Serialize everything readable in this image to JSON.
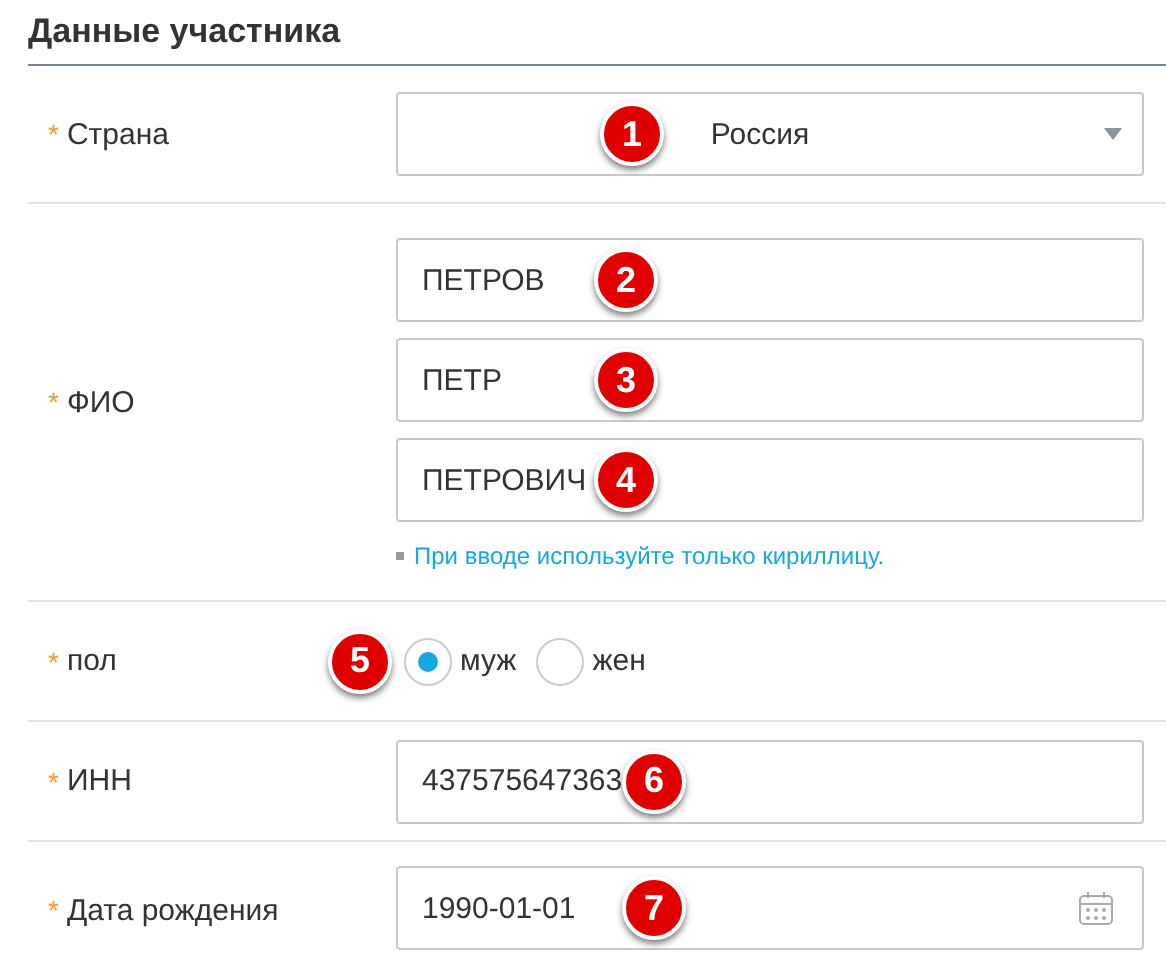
{
  "section_title": "Данные участника",
  "rows": [
    {
      "kind": "select",
      "label": "Страна",
      "required_mark": "*",
      "value": "Россия",
      "marker": "1"
    },
    {
      "kind": "fields",
      "label": "ФИО",
      "required_mark": "*",
      "fields": [
        {
          "value": "ПЕТРОВ",
          "marker": "2"
        },
        {
          "value": "ПЕТР",
          "marker": "3"
        },
        {
          "value": "ПЕТРОВИЧ",
          "marker": "4"
        }
      ],
      "hint": "При вводе используйте только кириллицу."
    },
    {
      "kind": "radio",
      "label": "пол",
      "required_mark": "*",
      "marker": "5",
      "options": [
        {
          "label": "муж",
          "selected": true
        },
        {
          "label": "жен",
          "selected": false
        }
      ]
    },
    {
      "kind": "text",
      "label": "ИНН",
      "required_mark": "*",
      "value": "437575647363",
      "marker": "6"
    },
    {
      "kind": "date",
      "label": "Дата рождения",
      "required_mark": "*",
      "value": "1990-01-01",
      "marker": "7"
    }
  ]
}
